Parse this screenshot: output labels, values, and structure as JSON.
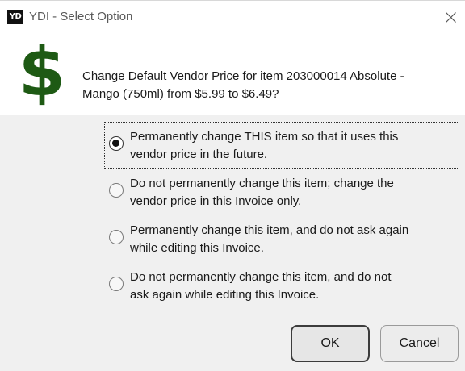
{
  "window": {
    "title": "YDI - Select Option",
    "app_icon_text": "YD"
  },
  "prompt": {
    "line1": "Change Default Vendor Price for item 203000014 Absolute -",
    "line2": "Mango (750ml) from $5.99 to $6.49?",
    "icon": "dollar-sign-icon",
    "icon_color": "#1e5a14"
  },
  "options": [
    {
      "line1": "Permanently change THIS item so that it uses this",
      "line2": "vendor price in the future.",
      "selected": true
    },
    {
      "line1": "Do not permanently change this item; change the",
      "line2": "vendor price in this Invoice only.",
      "selected": false
    },
    {
      "line1": "Permanently change this item, and do not ask again",
      "line2": "while editing this Invoice.",
      "selected": false
    },
    {
      "line1": "Do not permanently change this item, and do not",
      "line2": "ask again while editing this Invoice.",
      "selected": false
    }
  ],
  "buttons": {
    "ok_label": "OK",
    "cancel_label": "Cancel"
  }
}
